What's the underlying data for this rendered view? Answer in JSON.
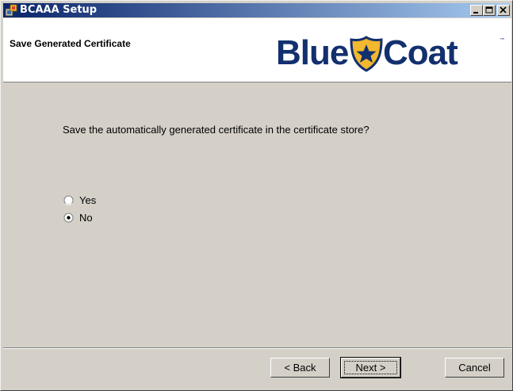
{
  "window": {
    "title": "BCAAA Setup"
  },
  "header": {
    "page_title": "Save Generated Certificate",
    "logo": {
      "word1": "Blue",
      "word2": "Coat",
      "trademark": "™",
      "brand_color": "#13306e",
      "badge_color": "#f2b82e"
    }
  },
  "body": {
    "question": "Save the automatically generated certificate in the certificate store?",
    "options": [
      {
        "label": "Yes",
        "selected": false
      },
      {
        "label": "No",
        "selected": true
      }
    ]
  },
  "footer": {
    "back_label": "< Back",
    "next_label": "Next >",
    "cancel_label": "Cancel"
  },
  "icons": {
    "app": "setup-icon",
    "minimize": "minimize-icon",
    "maximize": "maximize-icon",
    "close": "close-icon"
  }
}
